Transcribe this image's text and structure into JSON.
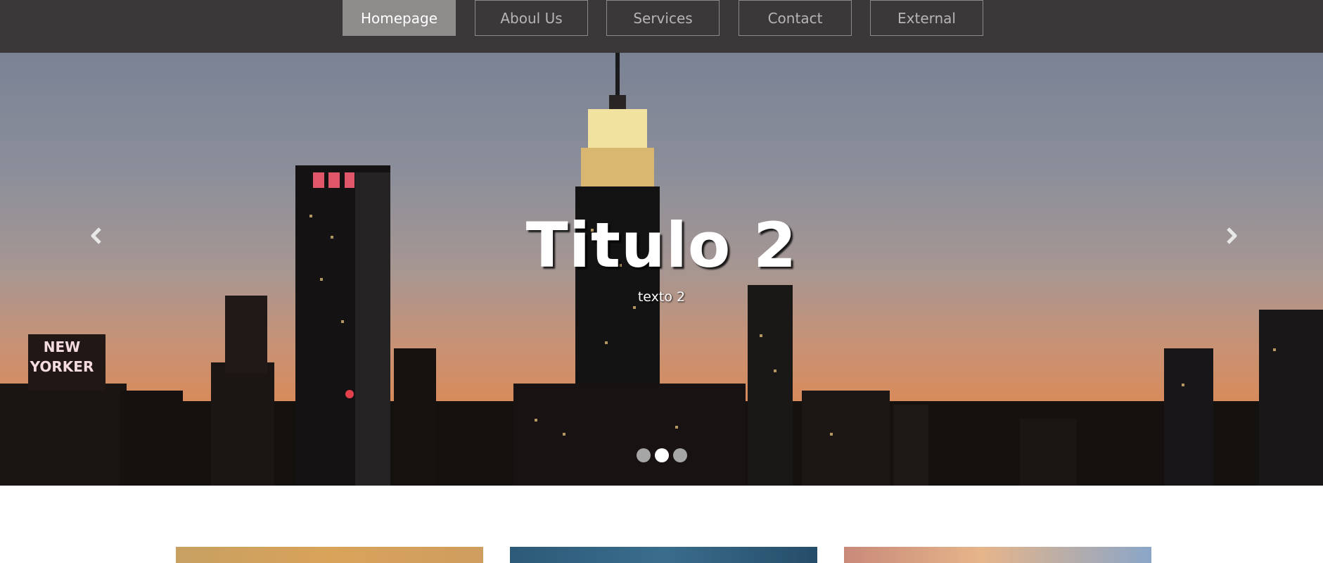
{
  "nav": {
    "items": [
      {
        "label": "Homepage",
        "active": true
      },
      {
        "label": "Aboul Us",
        "active": false
      },
      {
        "label": "Services",
        "active": false
      },
      {
        "label": "Contact",
        "active": false
      },
      {
        "label": "External",
        "active": false
      }
    ]
  },
  "carousel": {
    "title": "Titulo 2",
    "text": "texto 2",
    "prev_icon": "chevron-left-icon",
    "next_icon": "chevron-right-icon",
    "slides": 3,
    "active_slide": 2,
    "sign_text": [
      "NEW",
      "YORKER"
    ]
  },
  "colors": {
    "navbar_bg": "#3a3838",
    "nav_active_bg": "#8e8b8b",
    "nav_text": "#b9b5b5"
  }
}
